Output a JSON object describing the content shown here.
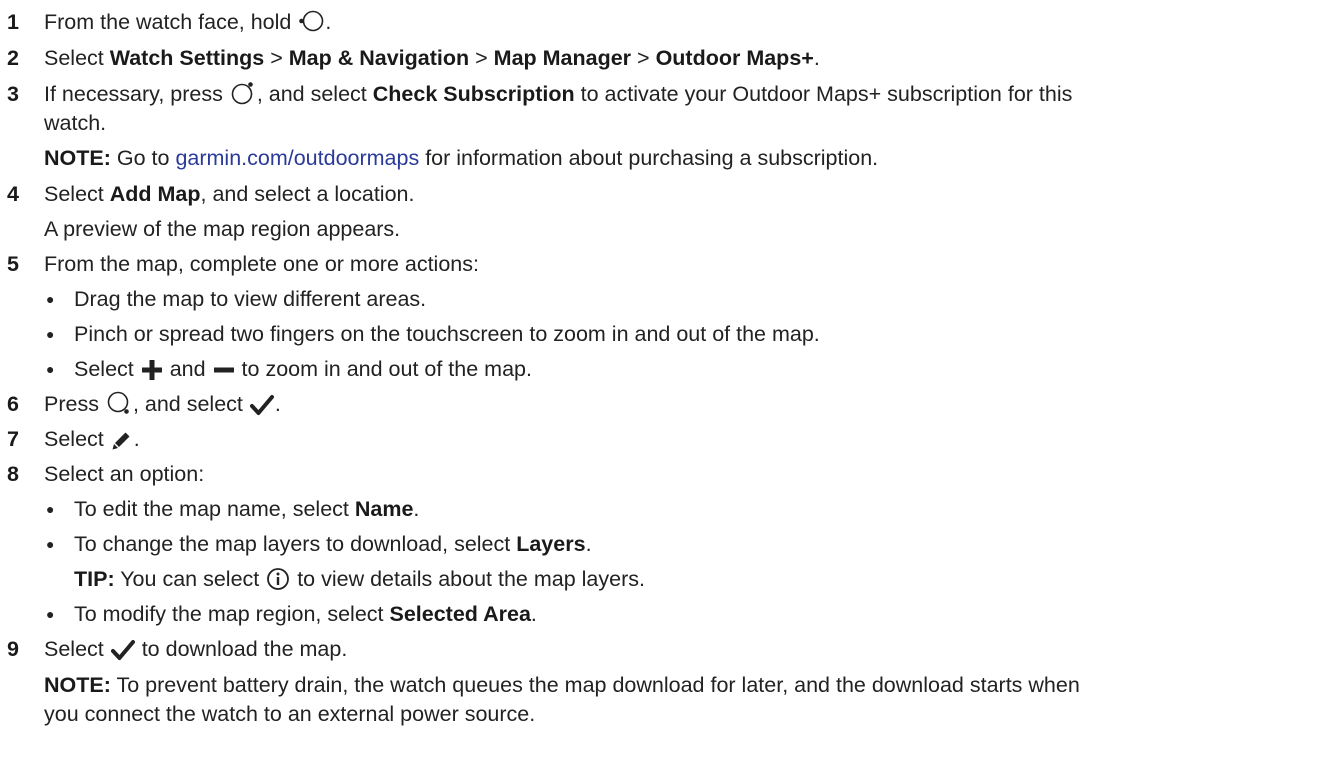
{
  "steps": [
    {
      "num": "1",
      "a": "From the watch face, hold ",
      "icon": "watch-button-left-icon",
      "b": "."
    },
    {
      "num": "2",
      "a": "Select ",
      "p1": "Watch Settings",
      "s1": " > ",
      "p2": "Map & Navigation",
      "s2": " > ",
      "p3": "Map Manager",
      "s3": " > ",
      "p4": "Outdoor Maps+",
      "b": "."
    },
    {
      "num": "3",
      "a": "If necessary, press ",
      "icon": "watch-button-top-right-icon",
      "b": ", and select ",
      "bold": "Check Subscription",
      "c": " to activate your Outdoor Maps+ subscription for this",
      "cont": "watch."
    },
    {
      "note_label": "NOTE:",
      "a": " Go to ",
      "link": "garmin.com/outdoormaps",
      "b": " for information about purchasing a subscription."
    },
    {
      "num": "4",
      "a": "Select ",
      "bold": "Add Map",
      "b": ", and select a location."
    },
    {
      "a": "A preview of the map region appears."
    },
    {
      "num": "5",
      "a": "From the map, complete one or more actions:"
    },
    {
      "bullet": "●",
      "a": "Drag the map to view different areas."
    },
    {
      "bullet": "●",
      "a": "Pinch or spread two fingers on the touchscreen to zoom in and out of the map."
    },
    {
      "bullet": "●",
      "a": "Select ",
      "icon1": "plus-icon",
      "b": " and ",
      "icon2": "minus-icon",
      "c": " to zoom in and out of the map."
    },
    {
      "num": "6",
      "a": "Press ",
      "icon": "watch-button-bottom-right-icon",
      "b": ", and select ",
      "icon2": "checkmark-icon",
      "c": "."
    },
    {
      "num": "7",
      "a": "Select ",
      "icon": "pencil-icon",
      "b": "."
    },
    {
      "num": "8",
      "a": "Select an option:"
    },
    {
      "bullet": "●",
      "a": "To edit the map name, select ",
      "bold": "Name",
      "b": "."
    },
    {
      "bullet": "●",
      "a": "To change the map layers to download, select ",
      "bold": "Layers",
      "b": "."
    },
    {
      "tip_label": "TIP:",
      "a": " You can select ",
      "icon": "info-icon",
      "b": " to view details about the map layers."
    },
    {
      "bullet": "●",
      "a": "To modify the map region, select ",
      "bold": "Selected Area",
      "b": "."
    },
    {
      "num": "9",
      "a": "Select ",
      "icon": "checkmark-icon",
      "b": " to download the map."
    },
    {
      "note_label": "NOTE:",
      "a": " To prevent battery drain, the watch queues the map download for later, and the download starts when",
      "cont": "you connect the watch to an external power source."
    }
  ]
}
